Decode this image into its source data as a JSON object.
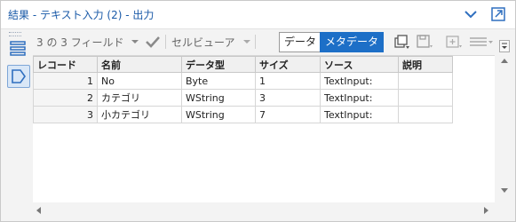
{
  "window": {
    "title": "結果 - テキスト入力 (2) - 出力",
    "chevron_icon": "chevron-down-icon",
    "expand_icon": "expand-icon"
  },
  "toolbar": {
    "field_count": "3 の 3 フィールド",
    "cell_viewer": "セルビューア",
    "tab_data": "データ",
    "tab_metadata": "メタデータ"
  },
  "grid": {
    "headers": [
      "レコード",
      "名前",
      "データ型",
      "サイズ",
      "ソース",
      "説明"
    ],
    "rows": [
      {
        "record": "1",
        "name": "No",
        "type": "Byte",
        "size": "1",
        "source": "TextInput:",
        "desc": ""
      },
      {
        "record": "2",
        "name": "カテゴリ",
        "type": "WString",
        "size": "3",
        "source": "TextInput:",
        "desc": ""
      },
      {
        "record": "3",
        "name": "小カテゴリ",
        "type": "WString",
        "size": "7",
        "source": "TextInput:",
        "desc": ""
      }
    ]
  },
  "colors": {
    "accent": "#1d6fc7",
    "title_text": "#1a5aa8",
    "icon_blue": "#2f6fbf"
  }
}
